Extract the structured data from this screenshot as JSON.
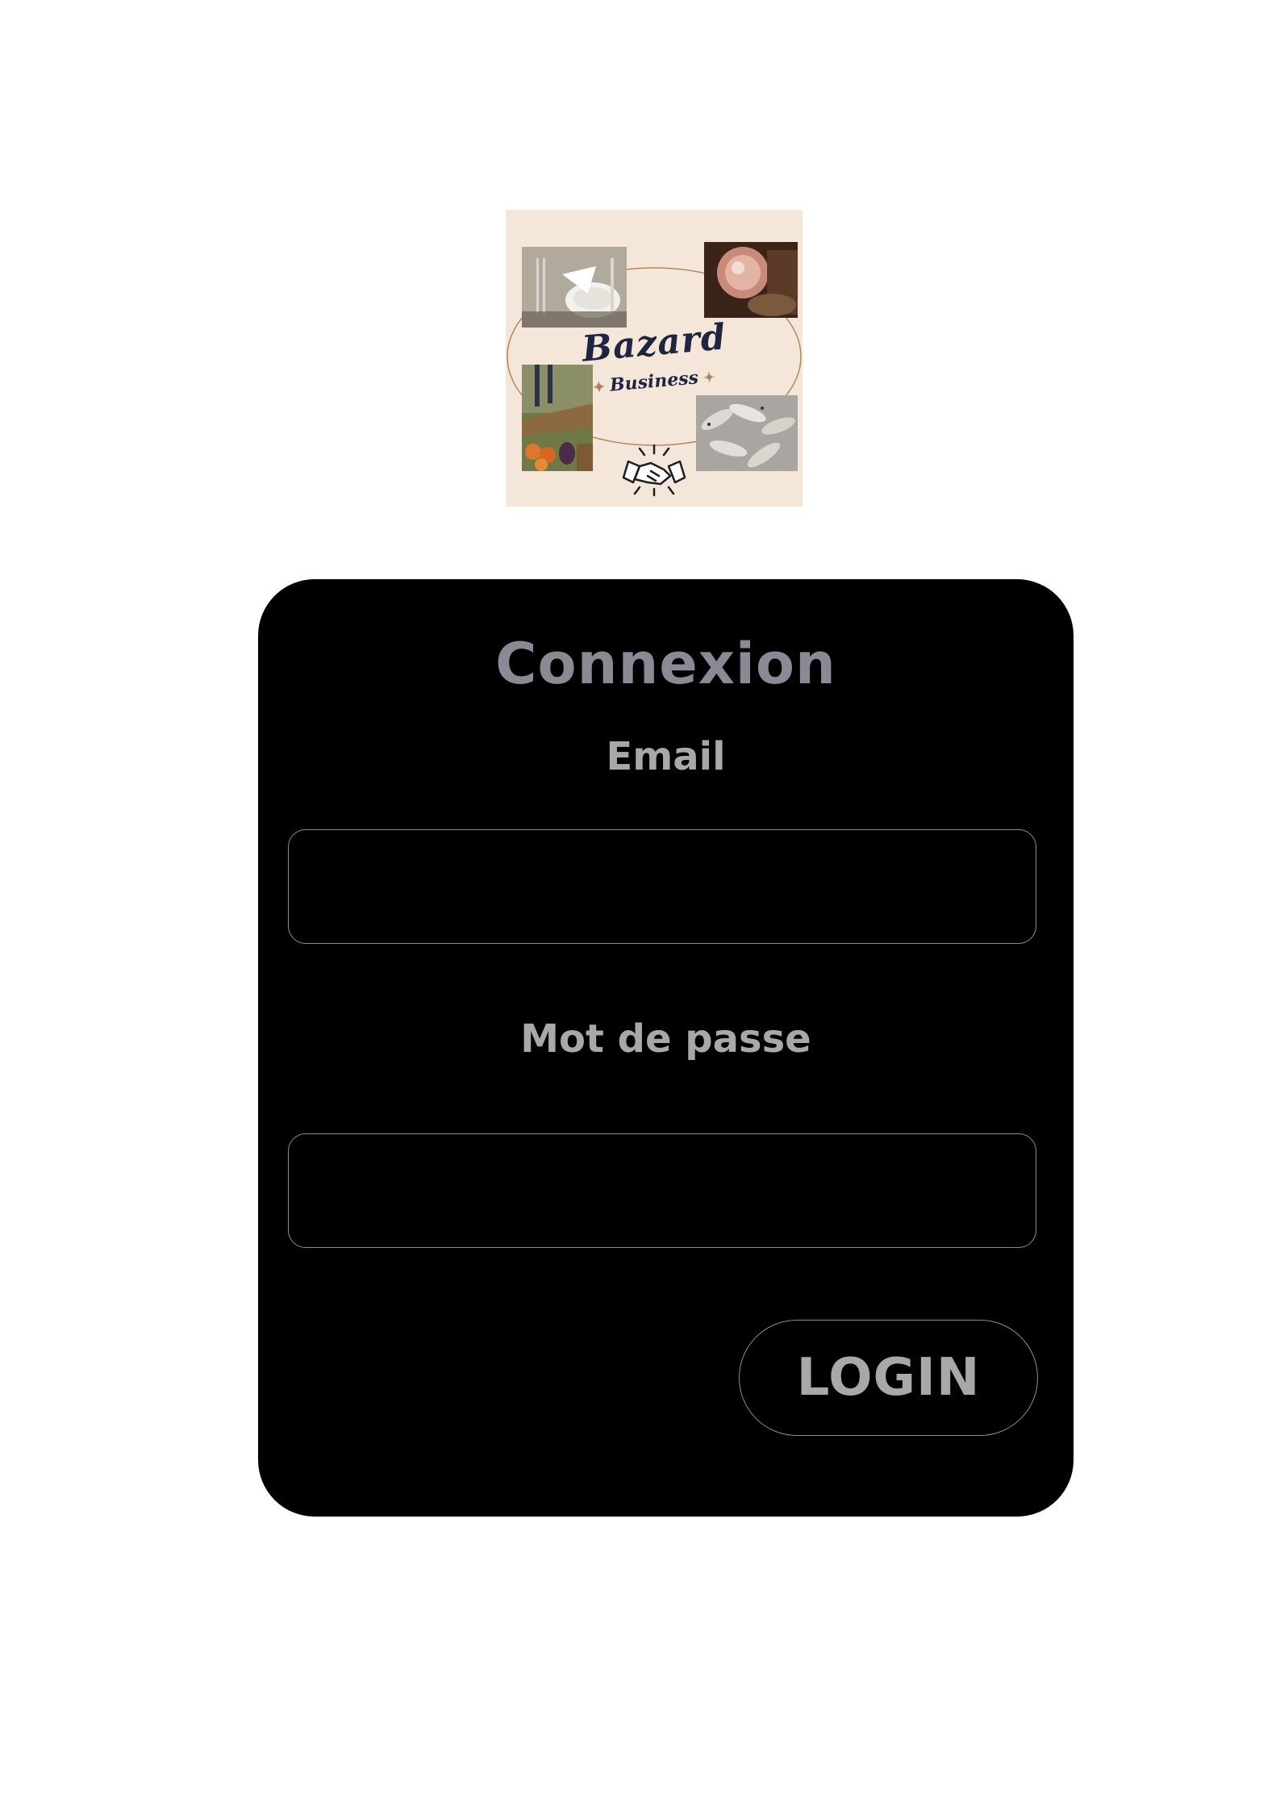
{
  "logo": {
    "brand_name": "Bazard",
    "brand_subtitle": "Business",
    "background_color": "#f4e7d9",
    "text_color": "#1e2540",
    "accent_color": "#a8845c"
  },
  "login_card": {
    "title": "Connexion",
    "email_label": "Email",
    "email_value": "",
    "password_label": "Mot de passe",
    "password_value": "",
    "login_button_label": "LOGIN",
    "card_color": "#000000",
    "text_color": "#a8a8a8",
    "border_color": "#8e8e8e"
  },
  "icons": {
    "handshake": "handshake-icon",
    "spark": "sparkle-icon"
  }
}
